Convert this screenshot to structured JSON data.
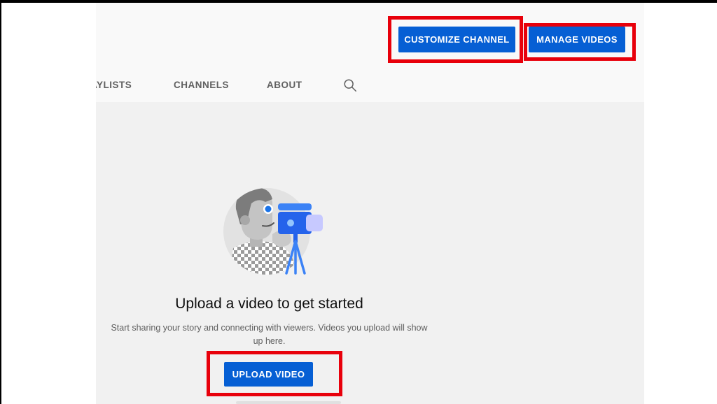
{
  "header": {
    "customize_label": "CUSTOMIZE CHANNEL",
    "manage_label": "MANAGE VIDEOS"
  },
  "tabs": [
    {
      "label": "AYLISTS"
    },
    {
      "label": "CHANNELS"
    },
    {
      "label": "ABOUT"
    }
  ],
  "search": {
    "icon": "search-icon"
  },
  "empty_state": {
    "title": "Upload a video to get started",
    "subtitle": "Start sharing your story and connecting with viewers. Videos you upload will show up here.",
    "upload_label": "UPLOAD VIDEO",
    "illustration": "camera-person-illustration"
  },
  "colors": {
    "accent": "#065fd4",
    "highlight": "#e8000b",
    "page_bg": "#f1f1f1",
    "header_bg": "#f9f9f9"
  }
}
